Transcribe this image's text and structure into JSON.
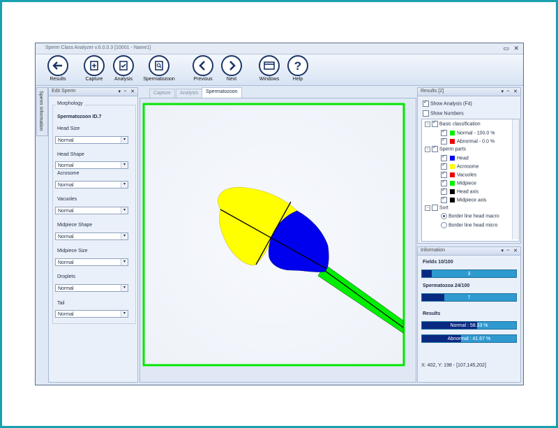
{
  "app": {
    "title": "Sperm Class Analyzer v.6.0.0.3  [10001 - Name1]",
    "pin_icon": "pin-icon",
    "close_icon": "close-icon"
  },
  "toolbar": [
    {
      "label": "Results",
      "icon": "arrow-left-icon"
    },
    {
      "label": "Capture",
      "icon": "capture-plus-icon"
    },
    {
      "label": "Analysis",
      "icon": "analysis-check-icon"
    },
    {
      "label": "Spermatozoon",
      "icon": "spermatozoon-search-icon"
    },
    {
      "label": "Previous",
      "icon": "chevron-left-icon"
    },
    {
      "label": "Next",
      "icon": "chevron-right-icon"
    },
    {
      "label": "Windows",
      "icon": "windows-icon"
    },
    {
      "label": "Help",
      "icon": "help-icon"
    }
  ],
  "side_tab": "Sperm Information",
  "edit_panel": {
    "title": "Edit Sperm",
    "group": "Morphology",
    "heading": "Spermatozoon ID.7",
    "fields": [
      {
        "label": "Head Size",
        "value": "Normal"
      },
      {
        "label": "Head Shape",
        "value": "Normal"
      },
      {
        "label": "Acrosome",
        "value": "Normal"
      },
      {
        "label": "Vacuoles",
        "value": "Normal"
      },
      {
        "label": "Midpiece Shape",
        "value": "Normal"
      },
      {
        "label": "Midpiece Size",
        "value": "Normal"
      },
      {
        "label": "Droplets",
        "value": "Normal"
      },
      {
        "label": "Tail",
        "value": "Normal"
      }
    ]
  },
  "tabs": [
    "Capture",
    "Analysis",
    "Spermatozoon"
  ],
  "active_tab": "Spermatozoon",
  "results_panel": {
    "title": "Results [2]",
    "show_analysis": "Show Analysis (F4)",
    "show_numbers": "Show Numbers",
    "basic": "Basic classification",
    "normal": "Normal - 100.0 %",
    "abnormal": "Abnormal - 0.0 %",
    "parts": "Sperm parts",
    "part_items": [
      {
        "label": "Head",
        "color": "#0000ee"
      },
      {
        "label": "Acrosome",
        "color": "#ffff00"
      },
      {
        "label": "Vacuoles",
        "color": "#ee0000"
      },
      {
        "label": "Midpiece",
        "color": "#00ee00"
      },
      {
        "label": "Head axis",
        "color": "#000000"
      },
      {
        "label": "Midpiece axis",
        "color": "#000000"
      }
    ],
    "sort": "Sort",
    "sort_opt1": "Border line head macro",
    "sort_opt2": "Border line head micro",
    "normal_color": "#00ee00",
    "abnormal_color": "#ee0000"
  },
  "info_panel": {
    "title": "Information",
    "fields_label": "Fields 10/100",
    "fields_value": "3",
    "fields_fraction": 0.1,
    "sperm_label": "Spermatozoa 24/100",
    "sperm_value": "7",
    "sperm_fraction": 0.24,
    "results_label": "Results",
    "normal_text": "Normal : 58.33 %",
    "normal_fraction": 0.5833,
    "abnormal_text": "Abnormal : 41.67 %",
    "abnormal_fraction": 0.4167,
    "coords": "X: 402, Y: 198 - [107,145,202]"
  }
}
